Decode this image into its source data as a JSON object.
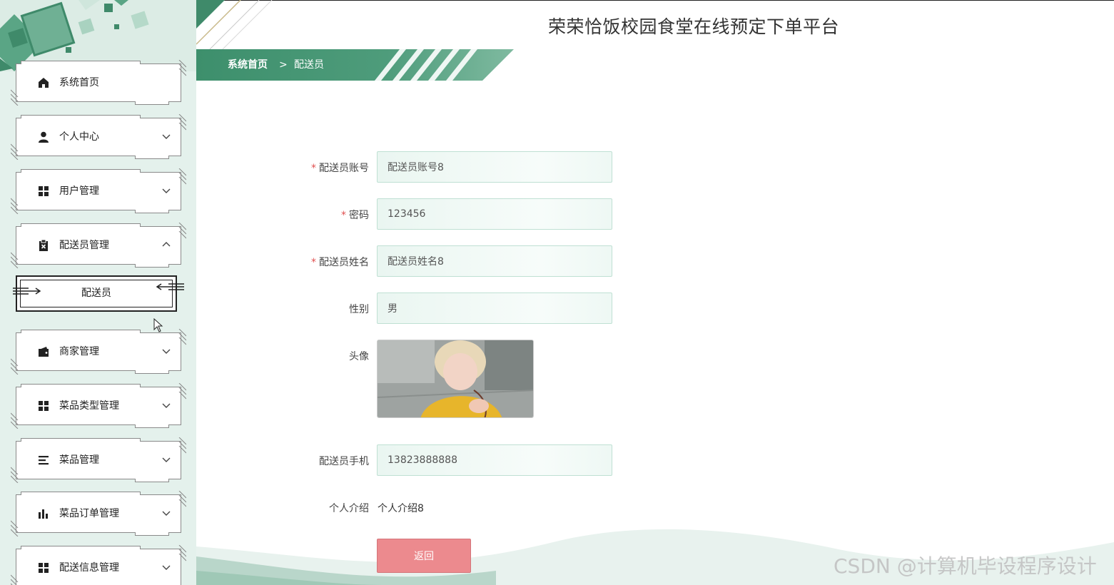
{
  "app": {
    "title": "荣荣恰饭校园食堂在线预定下单平台"
  },
  "breadcrumb": {
    "home": "系统首页",
    "separator": ">",
    "current": "配送员"
  },
  "sidebar": {
    "items": [
      {
        "label": "系统首页",
        "icon": "home-icon",
        "expandable": false
      },
      {
        "label": "个人中心",
        "icon": "person-icon",
        "expandable": true,
        "expanded": false
      },
      {
        "label": "用户管理",
        "icon": "grid-icon",
        "expandable": true,
        "expanded": false
      },
      {
        "label": "配送员管理",
        "icon": "clipboard-icon",
        "expandable": true,
        "expanded": true
      },
      {
        "label": "商家管理",
        "icon": "wallet-icon",
        "expandable": true,
        "expanded": false
      },
      {
        "label": "菜品类型管理",
        "icon": "grid-icon",
        "expandable": true,
        "expanded": false
      },
      {
        "label": "菜品管理",
        "icon": "list-icon",
        "expandable": true,
        "expanded": false
      },
      {
        "label": "菜品订单管理",
        "icon": "bar-chart-icon",
        "expandable": true,
        "expanded": false
      },
      {
        "label": "配送信息管理",
        "icon": "grid-icon",
        "expandable": true,
        "expanded": false
      }
    ],
    "submenu": {
      "label": "配送员"
    }
  },
  "form": {
    "account": {
      "label": "配送员账号",
      "value": "配送员账号8",
      "required": true
    },
    "password": {
      "label": "密码",
      "value": "123456",
      "required": true
    },
    "name": {
      "label": "配送员姓名",
      "value": "配送员姓名8",
      "required": true
    },
    "gender": {
      "label": "性别",
      "value": "男"
    },
    "avatar": {
      "label": "头像"
    },
    "phone": {
      "label": "配送员手机",
      "value": "13823888888"
    },
    "intro": {
      "label": "个人介绍",
      "value": "个人介绍8"
    },
    "required_mark": "*",
    "back_label": "返回"
  },
  "watermark": "CSDN @计算机毕设程序设计",
  "colors": {
    "primary": "#4a9a7a",
    "sidebar_bg": "#e4f1ec",
    "button": "#ec8a8e",
    "required": "#e05050"
  }
}
